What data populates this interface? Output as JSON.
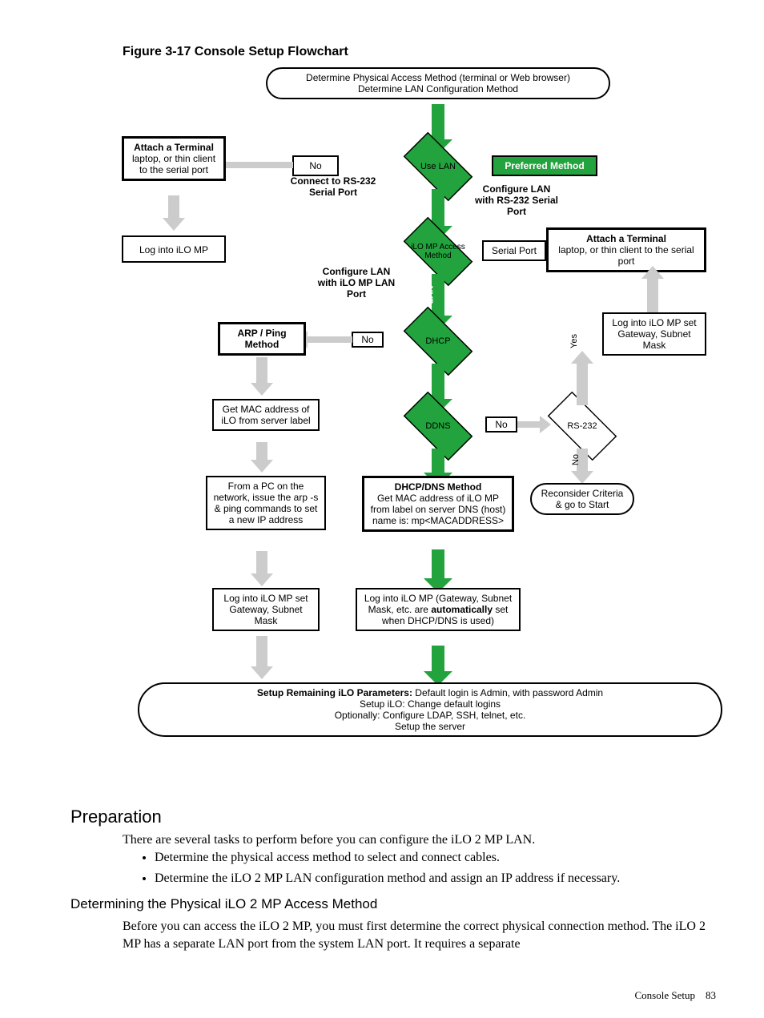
{
  "figure_caption": "Figure 3-17 Console Setup Flowchart",
  "flow": {
    "start1": "Determine Physical Access Method (terminal or Web browser)",
    "start2": "Determine LAN Configuration Method",
    "d_uselan": "Use LAN",
    "label_preferred": "Preferred Method",
    "no": "No",
    "yes": "Yes",
    "lan_lbl": "LAN",
    "connect_rs232": "Connect to RS-232\nSerial Port",
    "attach_term_a1": "Attach a Terminal",
    "attach_term_a2": "laptop, or thin client to the serial port",
    "login_left": "Log into iLO MP",
    "d_access": "iLO MP Access Method",
    "serial_port": "Serial Port",
    "cfg_lan_rs232": "Configure LAN with RS-232 Serial Port",
    "attach_term_b1": "Attach a Terminal",
    "attach_term_b2": "laptop, or thin client to the serial port",
    "cfg_lan_mp": "Configure LAN with iLO MP LAN Port",
    "arp_ping": "ARP / Ping Method",
    "d_dhcp": "DHCP",
    "login_r": "Log into iLO MP set Gateway, Subnet Mask",
    "yes_v": "Yes",
    "get_mac": "Get MAC address of iLO from server label",
    "d_ddns": "DDNS",
    "d_rs232": "RS-232",
    "no_v": "No",
    "from_pc": "From a PC on the network, issue the arp -s & ping commands to set a new IP address",
    "dhcp_dns_h": "DHCP/DNS Method",
    "dhcp_dns_b": "Get MAC address of iLO MP  from label on server DNS (host) name is: mp<MACADDRESS>",
    "reconsider": "Reconsider Criteria & go to Start",
    "login_bl": "Log into iLO MP set Gateway, Subnet Mask",
    "login_bc1": "Log into iLO MP (Gateway, Subnet Mask, etc. are ",
    "login_bc_auto": "automatically",
    "login_bc2": " set when DHCP/DNS is used)",
    "end_h": "Setup Remaining iLO Parameters:",
    "end_t": " Default login is Admin, with password Admin",
    "end_l2": "Setup iLO: Change default logins",
    "end_l3": "Optionally: Configure LDAP, SSH, telnet, etc.",
    "end_l4": "Setup the server"
  },
  "h_prep": "Preparation",
  "p_prep": "There are several tasks to perform before you can configure the iLO 2 MP LAN.",
  "bul1": "Determine the physical access method to select and connect cables.",
  "bul2": "Determine the iLO 2 MP LAN configuration method and assign an IP address if necessary.",
  "h_det": "Determining the Physical iLO 2 MP Access Method",
  "p_det": "Before you can access the iLO 2 MP, you must first determine the correct physical connection method. The iLO 2 MP has a separate LAN port from the system LAN port. It requires a separate",
  "footer_label": "Console Setup",
  "footer_page": "83"
}
